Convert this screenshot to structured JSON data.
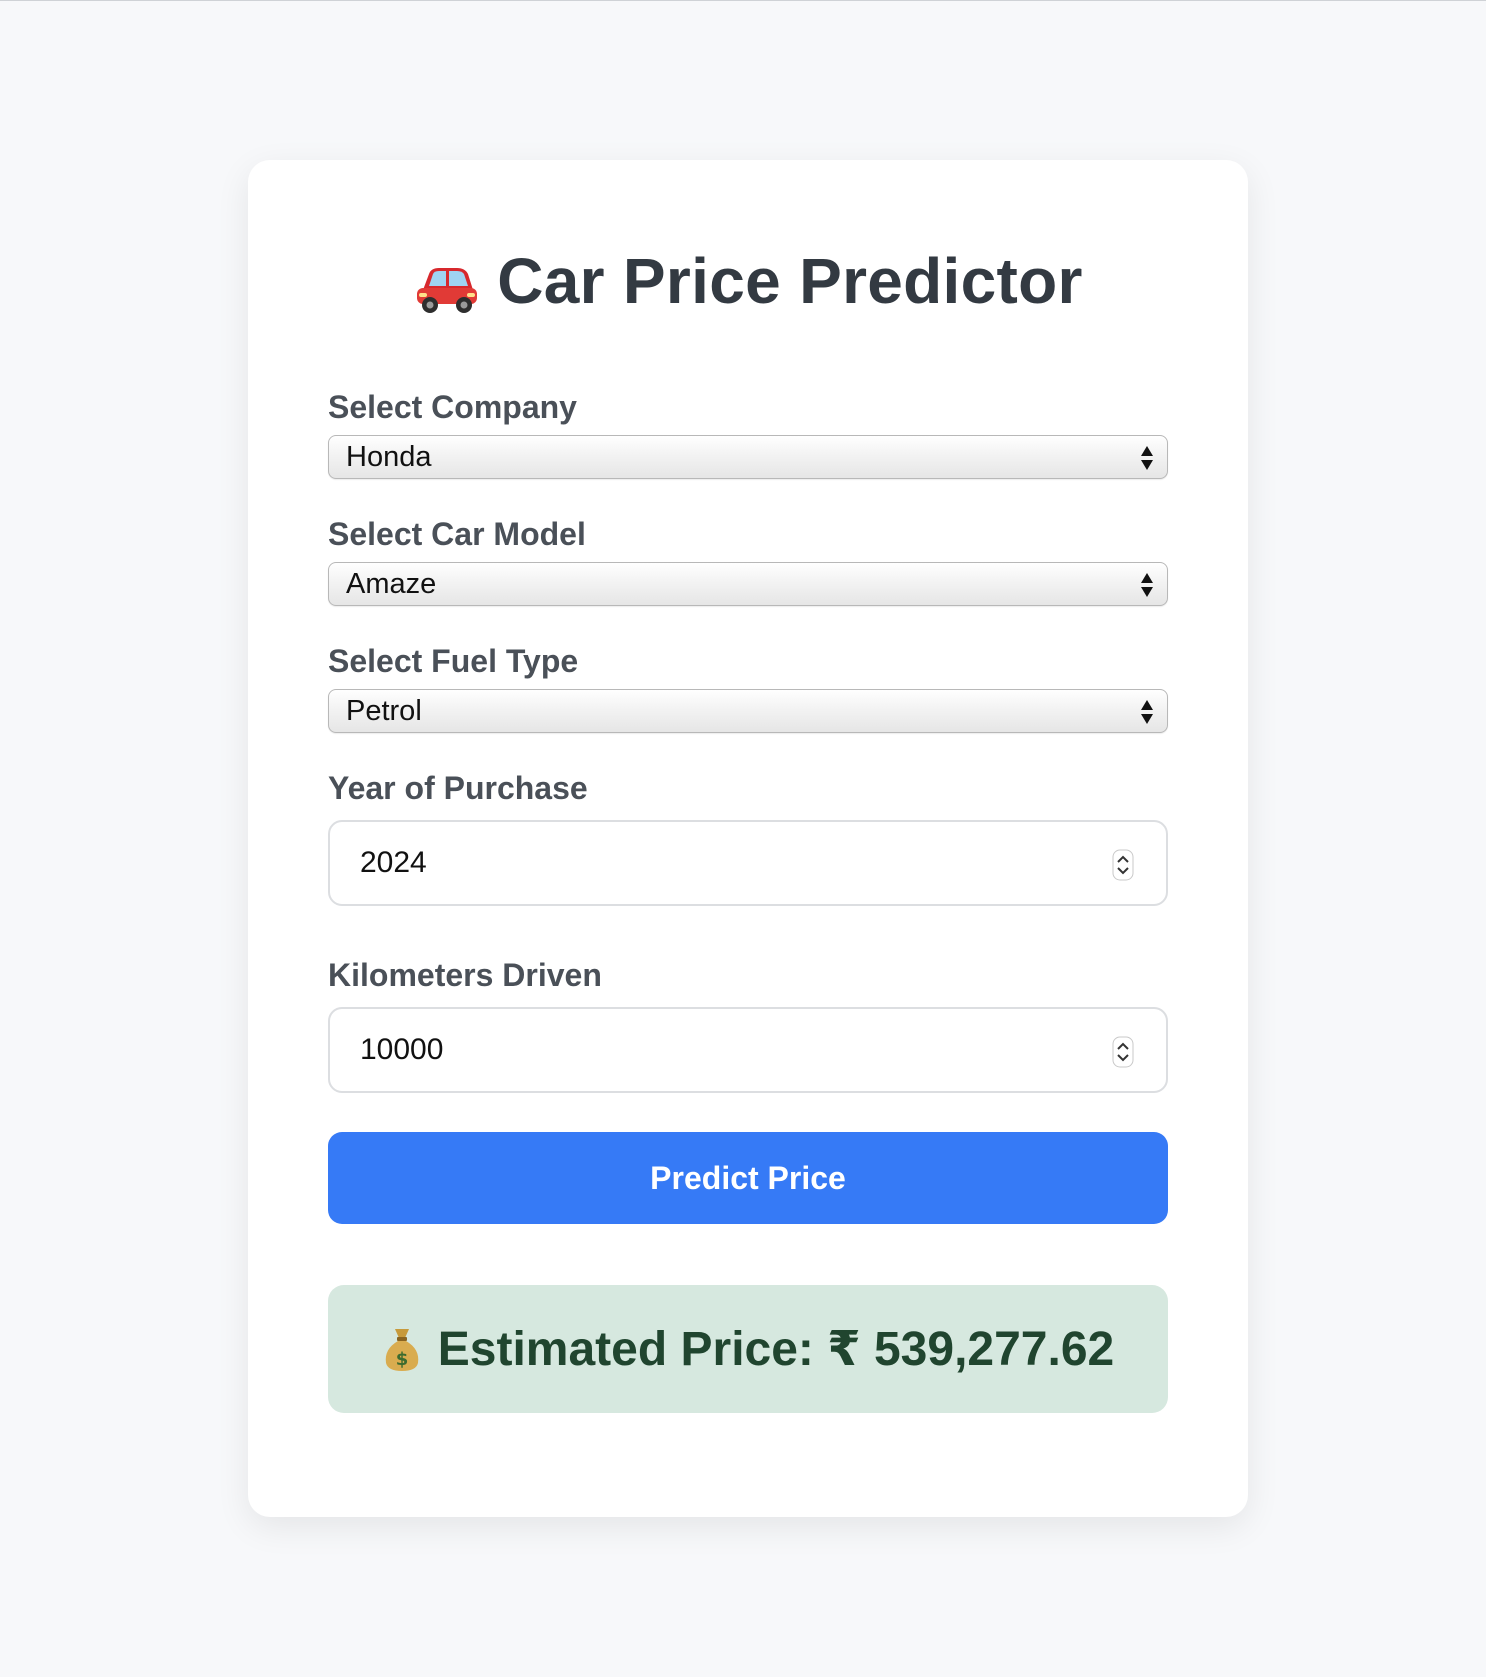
{
  "header": {
    "title": "Car Price Predictor",
    "title_icon": "car-icon"
  },
  "form": {
    "company": {
      "label": "Select Company",
      "value": "Honda"
    },
    "model": {
      "label": "Select Car Model",
      "value": "Amaze"
    },
    "fuel": {
      "label": "Select Fuel Type",
      "value": "Petrol"
    },
    "year": {
      "label": "Year of Purchase",
      "value": "2024"
    },
    "km": {
      "label": "Kilometers Driven",
      "value": "10000"
    },
    "submit_label": "Predict Price"
  },
  "result": {
    "icon": "money-bag-icon",
    "text": "Estimated Price: ₹ 539,277.62"
  },
  "colors": {
    "page_bg": "#f7f8fa",
    "card_bg": "#ffffff",
    "accent": "#367af6",
    "result_bg": "#d6e8df",
    "result_text": "#20452f",
    "title_text": "#333a42"
  }
}
